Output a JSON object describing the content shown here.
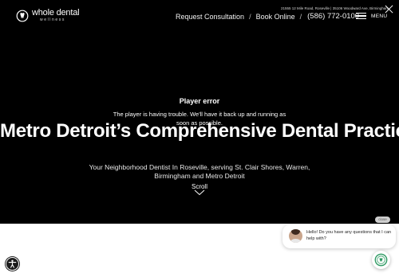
{
  "header": {
    "logo": {
      "name": "whole dental",
      "sub": "wellness"
    },
    "address": "21555 12 Mile Road, Roseville | 35106 Woodward Ave, Birmingham",
    "nav": {
      "request": "Request Consultation",
      "sep": "/",
      "book": "Book Online",
      "phone": "(586) 772-0100"
    },
    "menu_label": "MENU"
  },
  "player_error": {
    "title": "Player error",
    "message": "The player is having trouble. We'll have it back up and running as soon as possible."
  },
  "hero": {
    "headline": "Metro Detroit’s Comprehensive Dental Practice",
    "subline": "Your Neighborhood Dentist In Roseville, serving St. Clair Shores, Warren, Birmingham and Metro Detroit",
    "scroll_label": "Scroll"
  },
  "chat": {
    "close_label": "close",
    "message": "Hello! Do you have any questions that I can help with?"
  },
  "icons": {
    "logo": "tooth-logo-icon",
    "close": "close-icon",
    "menu": "hamburger-icon",
    "scroll": "chevron-down-icon",
    "chat": "chat-launcher-icon",
    "accessibility": "accessibility-icon"
  },
  "colors": {
    "hero_bg": "#000000",
    "text": "#ffffff",
    "chat_accent": "#2e9a63"
  }
}
